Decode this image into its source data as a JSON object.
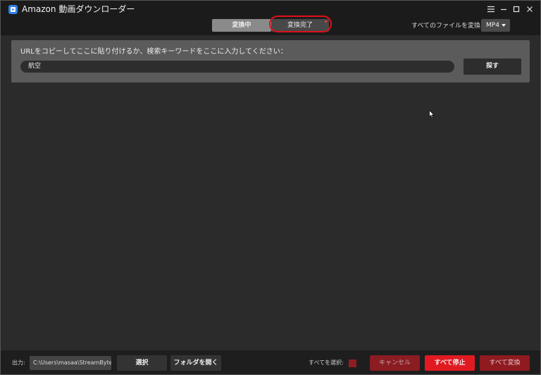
{
  "titlebar": {
    "title": "Amazon 動画ダウンローダー"
  },
  "toolbar": {
    "tabs": [
      {
        "label": "変換中",
        "active": true
      },
      {
        "label": "変換完了",
        "active": false,
        "has_notification": true
      }
    ],
    "convert_all_label": "すべてのファイルを変換:",
    "format_value": "MP4"
  },
  "search": {
    "prompt": "URLをコピーしてここに貼り付けるか、検索キーワードをここに入力してください：",
    "input_value": "航空",
    "button_label": "探す"
  },
  "bottom": {
    "output_label": "出力:",
    "output_path": "C:\\Users\\masaa\\StreamByte",
    "select_label": "選択",
    "open_folder_label": "フォルダを開く",
    "select_all_label": "すべてを選択:",
    "cancel_label": "キャンセル",
    "stop_all_label": "すべて停止",
    "convert_all_label": "すべて変換"
  },
  "colors": {
    "accent_red": "#e11a22",
    "highlight_ring": "#e0101a",
    "app_icon_blue": "#2f7fe6"
  },
  "icons": [
    "app-icon",
    "menu-icon",
    "minimize-icon",
    "maximize-icon",
    "close-icon",
    "chevron-down-icon",
    "mouse-cursor"
  ]
}
